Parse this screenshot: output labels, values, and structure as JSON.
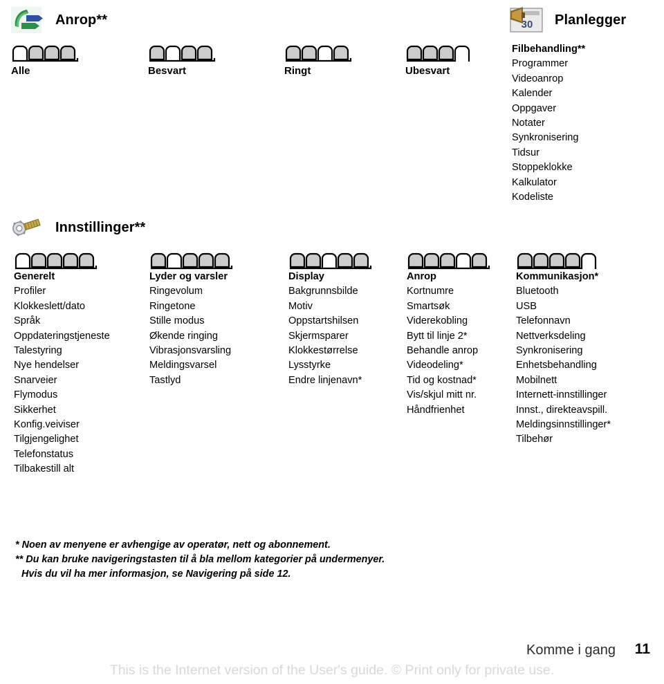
{
  "sections": {
    "anrop": {
      "icon": "call-log-icon",
      "title": "Anrop**",
      "tab_groups": [
        {
          "label": "Alle",
          "icon": "tabs-4-selected-1",
          "tab_count": 4,
          "selected": 1
        },
        {
          "label": "Besvart",
          "icon": "tabs-4-selected-2",
          "tab_count": 4,
          "selected": 2
        },
        {
          "label": "Ringt",
          "icon": "tabs-4-selected-3",
          "tab_count": 4,
          "selected": 3
        },
        {
          "label": "Ubesvart",
          "icon": "tabs-4-selected-4",
          "tab_count": 4,
          "selected": 4
        }
      ]
    },
    "planlegger": {
      "icon": "organizer-icon",
      "title": "Planlegger",
      "items": [
        "Filbehandling**",
        "Programmer",
        "Videoanrop",
        "Kalender",
        "Oppgaver",
        "Notater",
        "Synkronisering",
        "Tidsur",
        "Stoppeklokke",
        "Kalkulator",
        "Kodeliste"
      ]
    },
    "innstillinger": {
      "icon": "wrench-screw-icon",
      "title": "Innstillinger**",
      "columns": [
        {
          "header": "Generelt",
          "tab_count": 5,
          "selected": 1,
          "icon": "tabs-5-selected-1",
          "items": [
            "Profiler",
            "Klokkeslett/dato",
            "Språk",
            "Oppdateringstjeneste",
            "Talestyring",
            "Nye hendelser",
            "Snarveier",
            "Flymodus",
            "Sikkerhet",
            "Konfig.veiviser",
            "Tilgjengelighet",
            "Telefonstatus",
            "Tilbakestill alt"
          ]
        },
        {
          "header": "Lyder og varsler",
          "tab_count": 5,
          "selected": 2,
          "icon": "tabs-5-selected-2",
          "items": [
            "Ringevolum",
            "Ringetone",
            "Stille modus",
            "Økende ringing",
            "Vibrasjonsvarsling",
            "Meldingsvarsel",
            "Tastlyd"
          ]
        },
        {
          "header": "Display",
          "tab_count": 5,
          "selected": 3,
          "icon": "tabs-5-selected-3",
          "items": [
            "Bakgrunnsbilde",
            "Motiv",
            "Oppstartshilsen",
            "Skjermsparer",
            "Klokkestørrelse",
            "Lysstyrke",
            "Endre linjenavn*"
          ]
        },
        {
          "header": "Anrop",
          "tab_count": 5,
          "selected": 4,
          "icon": "tabs-5-selected-4",
          "items": [
            "Kortnumre",
            "Smartsøk",
            "Viderekobling",
            "Bytt til linje 2*",
            "Behandle anrop",
            "Videodeling*",
            "Tid og kostnad*",
            "Vis/skjul mitt nr.",
            "Håndfrienhet"
          ]
        },
        {
          "header": "Kommunikasjon*",
          "tab_count": 5,
          "selected": 5,
          "icon": "tabs-5-selected-5",
          "items": [
            "Bluetooth",
            "USB",
            "Telefonnavn",
            "Nettverksdeling",
            "Synkronisering",
            "Enhetsbehandling",
            "Mobilnett",
            "Internett-innstillinger",
            "Innst., direkteavspill.",
            "Meldingsinnstillinger*",
            "Tilbehør"
          ]
        }
      ]
    }
  },
  "footnotes": [
    "* Noen av menyene er avhengige av operatør, nett og abonnement.",
    "** Du kan bruke navigeringstasten til å bla mellom kategorier på undermenyer.",
    "Hvis du vil ha mer informasjon, se Navigering på side 12."
  ],
  "footer": {
    "chapter": "Komme i gang",
    "page_number": "11",
    "watermark": "This is the Internet version of the User's guide. © Print only for private use."
  },
  "colors": {
    "tab_fill": "#cccccc",
    "tab_stroke": "#000000",
    "watermark": "#d8d8d8",
    "text": "#000000",
    "icon_green": "#2f8f46",
    "icon_blue": "#2d4fa8"
  }
}
